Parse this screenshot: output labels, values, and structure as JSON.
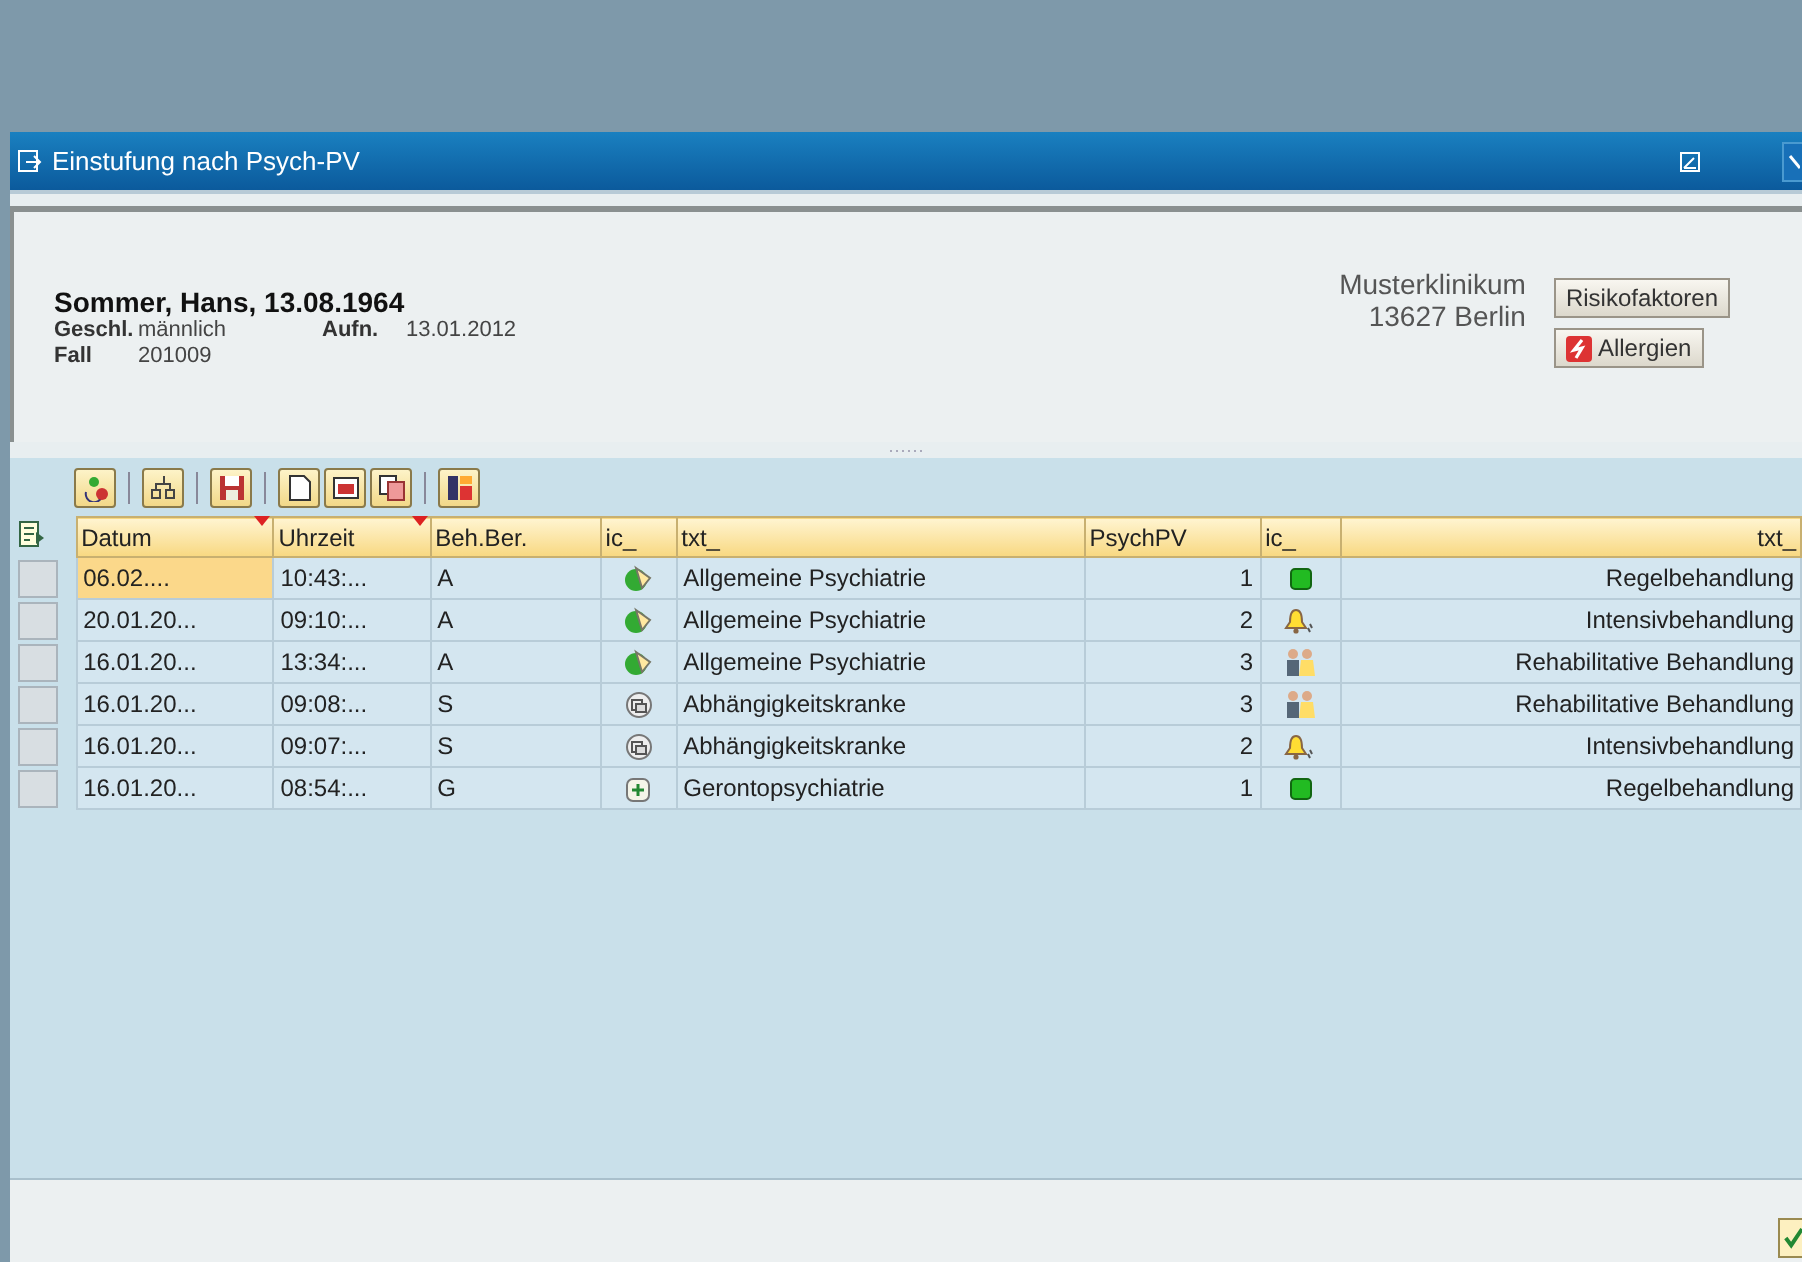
{
  "window": {
    "title": "Einstufung nach Psych-PV"
  },
  "patient": {
    "name": "Sommer, Hans, 13.08.1964",
    "fields": [
      {
        "label": "Geschl.",
        "value": "männlich"
      },
      {
        "label": "Aufn.",
        "value": "13.01.2012"
      },
      {
        "label": "Fall",
        "value": "201009"
      }
    ],
    "clinic": "Musterklinikum",
    "city": "13627 Berlin"
  },
  "buttons": [
    {
      "label": "Risikofaktoren",
      "kind": "plain"
    },
    {
      "label": "Allergien",
      "kind": "warning"
    }
  ],
  "toolbar": [
    {
      "kind": "refresh"
    },
    {
      "kind": "sep"
    },
    {
      "kind": "tree"
    },
    {
      "kind": "sep"
    },
    {
      "kind": "save"
    },
    {
      "kind": "sep"
    },
    {
      "kind": "new"
    },
    {
      "kind": "print"
    },
    {
      "kind": "copy"
    },
    {
      "kind": "sep"
    },
    {
      "kind": "layout"
    }
  ],
  "table": {
    "columns": [
      {
        "label": "Datum",
        "sorted": true
      },
      {
        "label": "Uhrzeit",
        "sorted": true
      },
      {
        "label": "Beh.Ber.",
        "sorted": false
      },
      {
        "label": "ic_",
        "sorted": false
      },
      {
        "label": "txt_",
        "sorted": false
      },
      {
        "label": "PsychPV",
        "sorted": false
      },
      {
        "label": "ic_",
        "sorted": false
      },
      {
        "label": "txt_",
        "sorted": false
      }
    ],
    "rows": [
      {
        "selected": true,
        "datum": "06.02....",
        "uhrzeit": "10:43:...",
        "bereich": "A",
        "area_icon": {
          "kind": "psych"
        },
        "fach": "Allgemeine Psychiatrie",
        "psychpv": "1",
        "level_icon": {
          "kind": "square"
        },
        "behandlung": "Regelbehandlung"
      },
      {
        "selected": false,
        "datum": "20.01.20...",
        "uhrzeit": "09:10:...",
        "bereich": "A",
        "area_icon": {
          "kind": "psych"
        },
        "fach": "Allgemeine Psychiatrie",
        "psychpv": "2",
        "level_icon": {
          "kind": "bell"
        },
        "behandlung": "Intensivbehandlung"
      },
      {
        "selected": false,
        "datum": "16.01.20...",
        "uhrzeit": "13:34:...",
        "bereich": "A",
        "area_icon": {
          "kind": "psych"
        },
        "fach": "Allgemeine Psychiatrie",
        "psychpv": "3",
        "level_icon": {
          "kind": "people"
        },
        "behandlung": "Rehabilitative Behandlung"
      },
      {
        "selected": false,
        "datum": "16.01.20...",
        "uhrzeit": "09:08:...",
        "bereich": "S",
        "area_icon": {
          "kind": "addiction"
        },
        "fach": "Abhängigkeitskranke",
        "psychpv": "3",
        "level_icon": {
          "kind": "people"
        },
        "behandlung": "Rehabilitative Behandlung"
      },
      {
        "selected": false,
        "datum": "16.01.20...",
        "uhrzeit": "09:07:...",
        "bereich": "S",
        "area_icon": {
          "kind": "addiction"
        },
        "fach": "Abhängigkeitskranke",
        "psychpv": "2",
        "level_icon": {
          "kind": "bell"
        },
        "behandlung": "Intensivbehandlung"
      },
      {
        "selected": false,
        "datum": "16.01.20...",
        "uhrzeit": "08:54:...",
        "bereich": "G",
        "area_icon": {
          "kind": "geronto"
        },
        "fach": "Gerontopsychiatrie",
        "psychpv": "1",
        "level_icon": {
          "kind": "square"
        },
        "behandlung": "Regelbehandlung"
      }
    ]
  }
}
